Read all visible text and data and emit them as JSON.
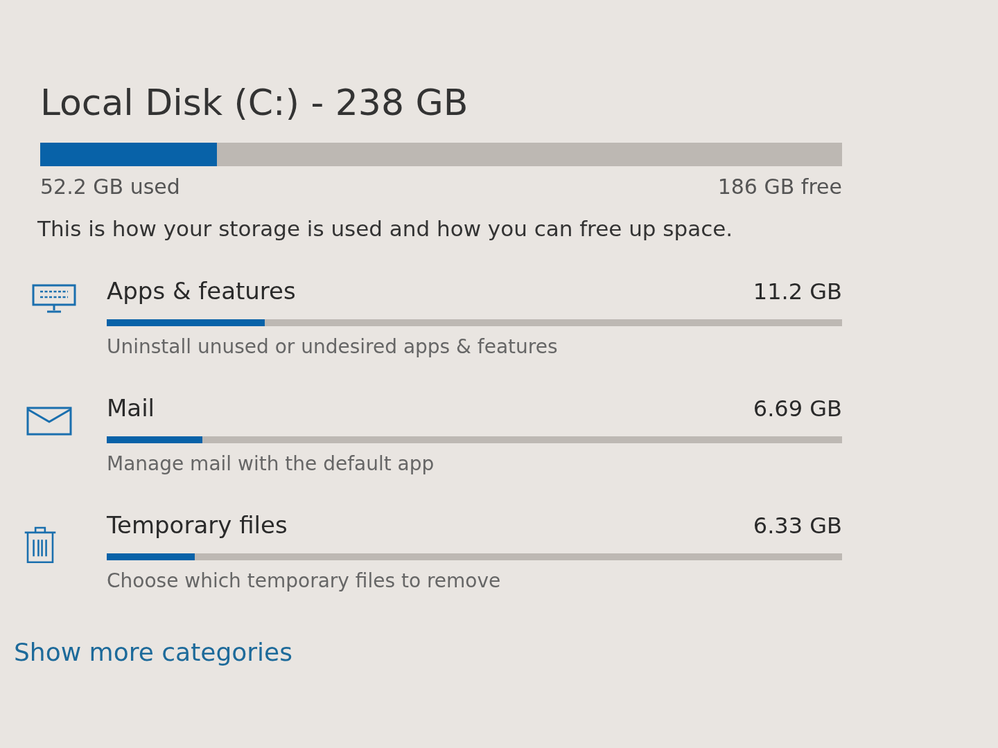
{
  "disk": {
    "title": "Local Disk (C:) - 238 GB",
    "level": 0.22,
    "used": "52.2 GB used",
    "free": "186 GB free"
  },
  "description": "This is how your storage is used and how you can free up space.",
  "categories": [
    {
      "kind": "apps",
      "name": "Apps & features",
      "size": "11.2 GB",
      "level": 0.215,
      "hint": "Uninstall unused or undesired apps & features"
    },
    {
      "kind": "mail",
      "name": "Mail",
      "size": "6.69 GB",
      "level": 0.13,
      "hint": "Manage mail with the default app"
    },
    {
      "kind": "temp",
      "name": "Temporary files",
      "size": "6.33 GB",
      "level": 0.12,
      "hint": "Choose which temporary files to remove"
    }
  ],
  "more_link": "Show more categories"
}
